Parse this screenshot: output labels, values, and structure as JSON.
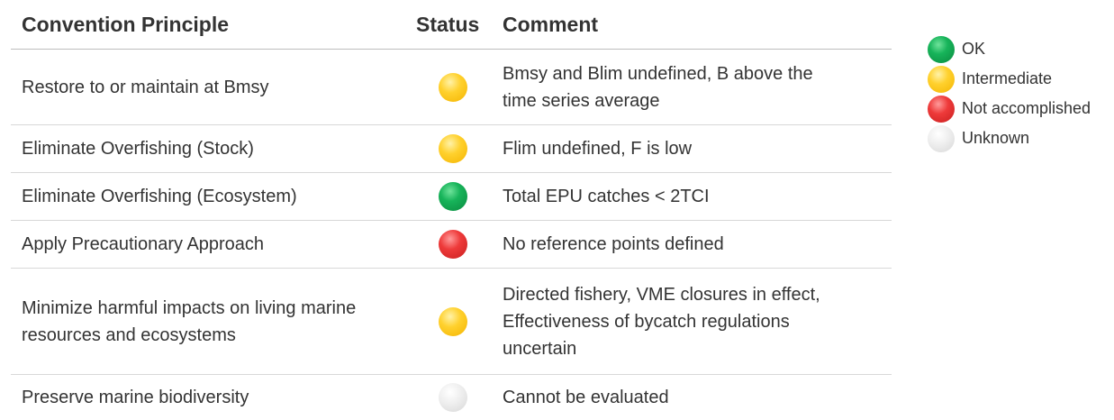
{
  "header": {
    "principle": "Convention Principle",
    "status": "Status",
    "comment": "Comment"
  },
  "rows": [
    {
      "principle": "Restore to or maintain at Bmsy",
      "status": "yellow",
      "comment_lines": [
        "Bmsy and Blim undefined, B above the",
        "time series average"
      ]
    },
    {
      "principle": "Eliminate Overfishing (Stock)",
      "status": "yellow",
      "comment_lines": [
        "Flim undefined, F is low"
      ]
    },
    {
      "principle": "Eliminate Overfishing (Ecosystem)",
      "status": "green",
      "comment_lines": [
        "Total EPU catches < 2TCI"
      ]
    },
    {
      "principle": "Apply Precautionary Approach",
      "status": "red",
      "comment_lines": [
        "No reference points defined"
      ]
    },
    {
      "principle": "Minimize harmful impacts on living marine resources and ecosystems",
      "status": "yellow",
      "comment_lines": [
        "Directed fishery, VME closures in effect,",
        "Effectiveness of bycatch regulations",
        "uncertain"
      ]
    },
    {
      "principle": "Preserve marine biodiversity",
      "status": "grey",
      "comment_lines": [
        "Cannot be evaluated"
      ]
    }
  ],
  "legend": [
    {
      "label": "OK",
      "status": "green"
    },
    {
      "label": "Intermediate",
      "status": "yellow"
    },
    {
      "label": "Not accomplished",
      "status": "red"
    },
    {
      "label": "Unknown",
      "status": "grey"
    }
  ],
  "colors": {
    "green": "#17b45a",
    "yellow": "#ffd12e",
    "red": "#ee3a3a",
    "grey": "#e6e6e6"
  }
}
